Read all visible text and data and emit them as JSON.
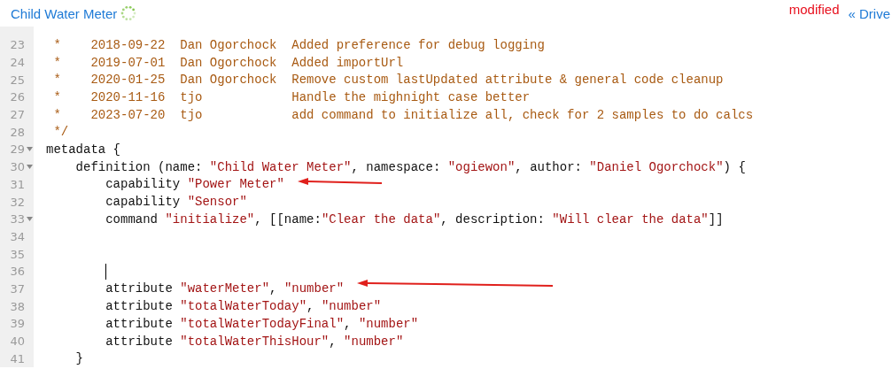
{
  "header": {
    "title": "Child Water Meter",
    "status": "modified",
    "back_link": "« Drive"
  },
  "editor": {
    "lines": [
      {
        "number": "23",
        "foldable": false,
        "cursor": false,
        "tokens": [
          {
            "kind": "comment",
            "text": " *    2018-09-22  Dan Ogorchock  Added preference for debug logging"
          }
        ]
      },
      {
        "number": "24",
        "foldable": false,
        "cursor": false,
        "tokens": [
          {
            "kind": "comment",
            "text": " *    2019-07-01  Dan Ogorchock  Added importUrl"
          }
        ]
      },
      {
        "number": "25",
        "foldable": false,
        "cursor": false,
        "tokens": [
          {
            "kind": "comment",
            "text": " *    2020-01-25  Dan Ogorchock  Remove custom lastUpdated attribute & general code cleanup"
          }
        ]
      },
      {
        "number": "26",
        "foldable": false,
        "cursor": false,
        "tokens": [
          {
            "kind": "comment",
            "text": " *    2020-11-16  tjo            Handle the mighnight case better"
          }
        ]
      },
      {
        "number": "27",
        "foldable": false,
        "cursor": false,
        "tokens": [
          {
            "kind": "comment",
            "text": " *    2023-07-20  tjo            add command to initialize all, check for 2 samples to do calcs"
          }
        ]
      },
      {
        "number": "28",
        "foldable": false,
        "cursor": false,
        "tokens": [
          {
            "kind": "comment",
            "text": " */"
          }
        ]
      },
      {
        "number": "29",
        "foldable": true,
        "cursor": false,
        "tokens": [
          {
            "kind": "plain",
            "text": "metadata {"
          }
        ]
      },
      {
        "number": "30",
        "foldable": true,
        "cursor": false,
        "tokens": [
          {
            "kind": "plain",
            "text": "    definition (name: "
          },
          {
            "kind": "string",
            "text": "\"Child Water Meter\""
          },
          {
            "kind": "plain",
            "text": ", namespace: "
          },
          {
            "kind": "string",
            "text": "\"ogiewon\""
          },
          {
            "kind": "plain",
            "text": ", author: "
          },
          {
            "kind": "string",
            "text": "\"Daniel Ogorchock\""
          },
          {
            "kind": "plain",
            "text": ") {"
          }
        ]
      },
      {
        "number": "31",
        "foldable": false,
        "cursor": false,
        "tokens": [
          {
            "kind": "plain",
            "text": "        capability "
          },
          {
            "kind": "string",
            "text": "\"Power Meter\""
          }
        ]
      },
      {
        "number": "32",
        "foldable": false,
        "cursor": false,
        "tokens": [
          {
            "kind": "plain",
            "text": "        capability "
          },
          {
            "kind": "string",
            "text": "\"Sensor\""
          }
        ]
      },
      {
        "number": "33",
        "foldable": true,
        "cursor": false,
        "tokens": [
          {
            "kind": "plain",
            "text": "        command "
          },
          {
            "kind": "string",
            "text": "\"initialize\""
          },
          {
            "kind": "plain",
            "text": ", [[name:"
          },
          {
            "kind": "string",
            "text": "\"Clear the data\""
          },
          {
            "kind": "plain",
            "text": ", description: "
          },
          {
            "kind": "string",
            "text": "\"Will clear the data\""
          },
          {
            "kind": "plain",
            "text": "]]"
          }
        ]
      },
      {
        "number": "34",
        "foldable": false,
        "cursor": false
      },
      {
        "number": "35",
        "foldable": false,
        "cursor": false
      },
      {
        "number": "36",
        "foldable": false,
        "cursor": true
      },
      {
        "number": "37",
        "foldable": false,
        "cursor": false,
        "tokens": [
          {
            "kind": "plain",
            "text": "        attribute "
          },
          {
            "kind": "string",
            "text": "\"waterMeter\""
          },
          {
            "kind": "plain",
            "text": ", "
          },
          {
            "kind": "string",
            "text": "\"number\""
          }
        ]
      },
      {
        "number": "38",
        "foldable": false,
        "cursor": false,
        "tokens": [
          {
            "kind": "plain",
            "text": "        attribute "
          },
          {
            "kind": "string",
            "text": "\"totalWaterToday\""
          },
          {
            "kind": "plain",
            "text": ", "
          },
          {
            "kind": "string",
            "text": "\"number\""
          }
        ]
      },
      {
        "number": "39",
        "foldable": false,
        "cursor": false,
        "tokens": [
          {
            "kind": "plain",
            "text": "        attribute "
          },
          {
            "kind": "string",
            "text": "\"totalWaterTodayFinal\""
          },
          {
            "kind": "plain",
            "text": ", "
          },
          {
            "kind": "string",
            "text": "\"number\""
          }
        ]
      },
      {
        "number": "40",
        "foldable": false,
        "cursor": false,
        "tokens": [
          {
            "kind": "plain",
            "text": "        attribute "
          },
          {
            "kind": "string",
            "text": "\"totalWaterThisHour\""
          },
          {
            "kind": "plain",
            "text": ", "
          },
          {
            "kind": "string",
            "text": "\"number\""
          }
        ]
      },
      {
        "number": "41",
        "foldable": false,
        "cursor": false,
        "tokens": [
          {
            "kind": "plain",
            "text": "    }"
          }
        ]
      }
    ]
  }
}
